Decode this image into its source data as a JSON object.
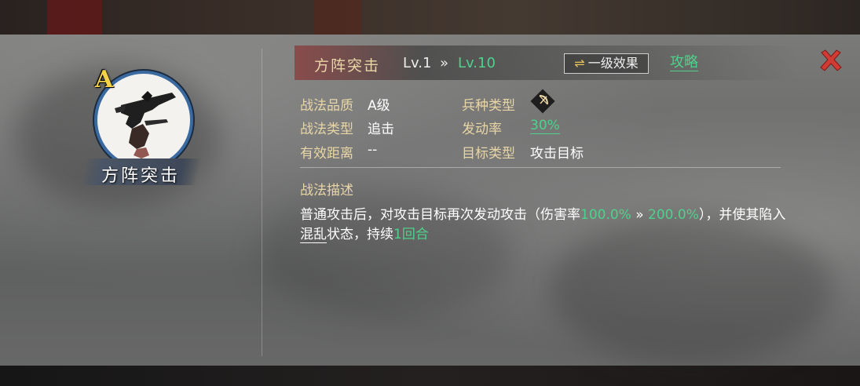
{
  "skill": {
    "grade_badge": "A",
    "name": "方阵突击"
  },
  "header": {
    "title": "方阵突击",
    "level_current": "Lv.1",
    "level_arrow": "»",
    "level_max": "Lv.10",
    "effect_button_icon": "⇌",
    "effect_button_label": "一级效果",
    "guide_link": "攻略",
    "close_icon": "close-x-icon"
  },
  "attributes": {
    "quality_label": "战法品质",
    "quality_value": "A级",
    "troop_label": "兵种类型",
    "troop_icon": "bow-troop-icon",
    "type_label": "战法类型",
    "type_value": "追击",
    "rate_label": "发动率",
    "rate_value": "30%",
    "range_label": "有效距离",
    "range_value": "--",
    "target_label": "目标类型",
    "target_value": "攻击目标"
  },
  "description": {
    "title": "战法描述",
    "part1": "普通攻击后，对攻击目标再次发动攻击（伤害率",
    "dmg_low": "100.0%",
    "arrow": " » ",
    "dmg_high": "200.0%",
    "part2": "），并使其陷入",
    "status": "混乱",
    "part3": "状态，持续",
    "duration": "1回合"
  },
  "colors": {
    "accent_green": "#4fd18c",
    "label_gold": "#e9d6a6",
    "grade_yellow": "#f3d24a",
    "close_red": "#d23a34"
  }
}
